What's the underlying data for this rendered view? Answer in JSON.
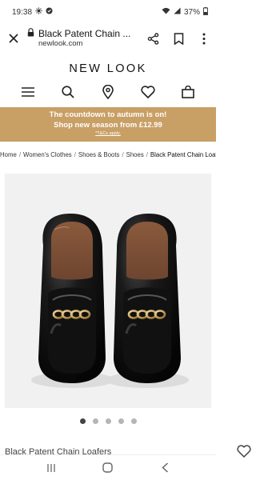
{
  "status": {
    "time": "19:38",
    "battery": "37%"
  },
  "browser": {
    "title": "Black Patent Chain ...",
    "url": "newlook.com"
  },
  "site": {
    "logo": "NEW LOOK"
  },
  "promo": {
    "line1": "The countdown to autumn is on!",
    "line2": "Shop new season from £12.99",
    "tc": "*T&Cs apply."
  },
  "breadcrumb": [
    "Home",
    "Women's Clothes",
    "Shoes & Boots",
    "Shoes",
    "Black Patent Chain Loafers"
  ],
  "carousel": {
    "total": 5,
    "active": 0
  },
  "product": {
    "title": "Black Patent Chain Loafers"
  },
  "colors": {
    "promo_bg": "#c89f65",
    "dot_active": "#444444",
    "dot_inactive": "#b5b5b5"
  }
}
